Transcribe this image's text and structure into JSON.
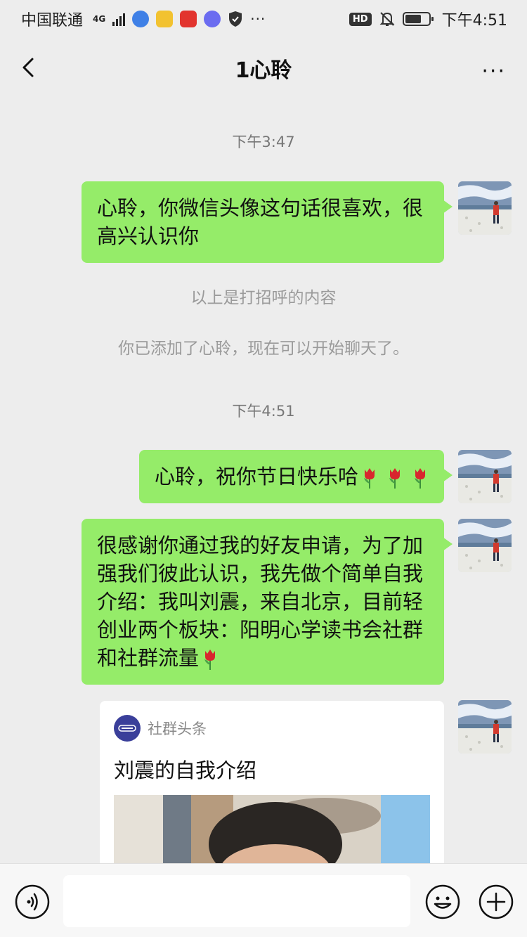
{
  "status_bar": {
    "carrier": "中国联通",
    "network": "4G",
    "hd": "HD",
    "time": "下午4:51",
    "icons": [
      "browser-icon",
      "files-icon",
      "huawei-store-icon",
      "music-icon",
      "shield-icon",
      "more-dots-icon",
      "mute-bell-icon",
      "battery-icon"
    ]
  },
  "header": {
    "title": "1心聆",
    "back_icon": "chevron-left-icon",
    "more_icon": "more-icon",
    "more_label": "···"
  },
  "chat": {
    "timestamp_1": "下午3:47",
    "msg_1": "心聆，你微信头像这句话很喜欢，很高兴认识你",
    "note_greeting": "以上是打招呼的内容",
    "note_added": "你已添加了心聆，现在可以开始聊天了。",
    "timestamp_2": "下午4:51",
    "msg_2": "心聆，祝你节日快乐哈",
    "msg_3": "很感谢你通过我的好友申请，为了加强我们彼此认识，我先做个简单自我介绍：我叫刘震，来自北京，目前轻创业两个板块：阳明心学读书会社群和社群流量",
    "card": {
      "source": "社群头条",
      "title": "刘震的自我介绍"
    }
  },
  "input_bar": {
    "placeholder": "",
    "voice_icon": "voice-icon",
    "emoji_icon": "emoji-icon",
    "plus_icon": "plus-icon"
  },
  "colors": {
    "bubble_green": "#95ec69",
    "background": "#ededed"
  }
}
